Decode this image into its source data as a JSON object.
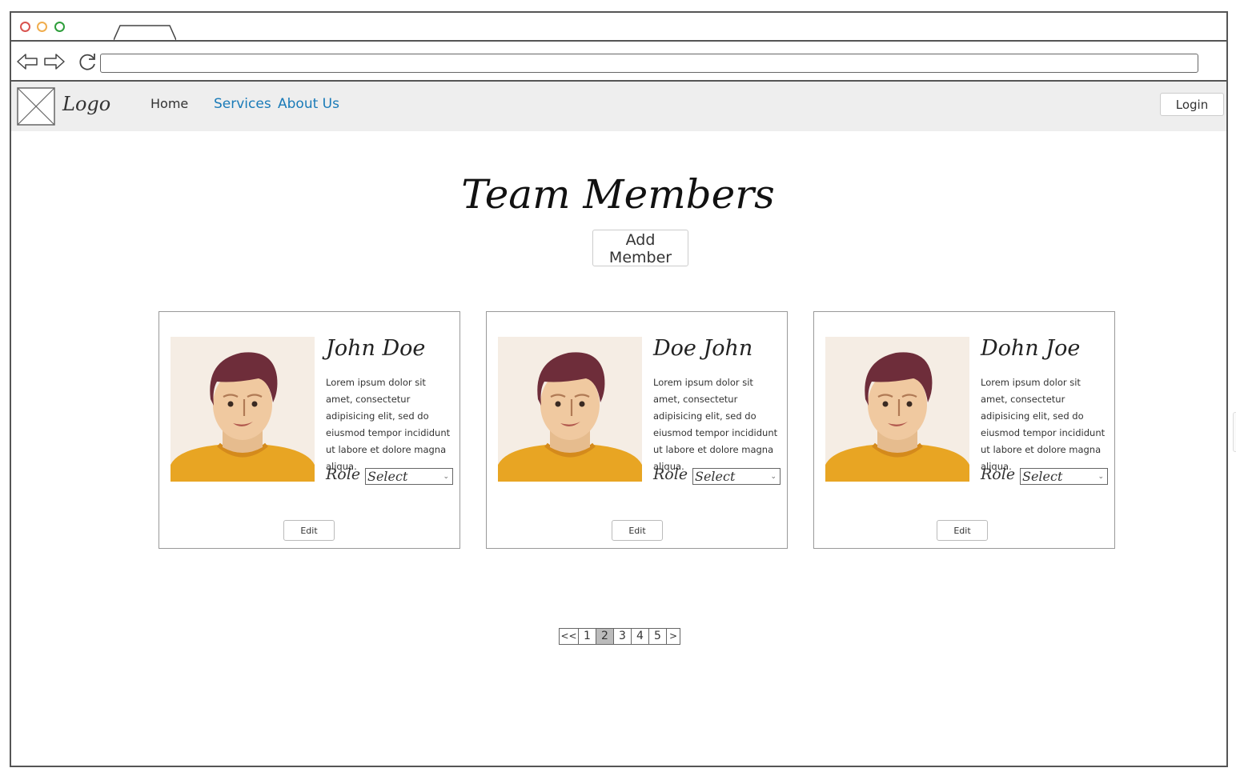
{
  "browser": {
    "url": "",
    "back_icon": "arrow-left-icon",
    "forward_icon": "arrow-right-icon",
    "reload_icon": "reload-icon"
  },
  "navbar": {
    "logo_label": "Logo",
    "links": [
      "Home",
      "Services",
      "About Us"
    ],
    "login_label": "Login",
    "link_color": "#1a7bb8",
    "background": "#eeeeee"
  },
  "main": {
    "title": "Team Members",
    "add_label": "Add Member"
  },
  "members": [
    {
      "name": "John Doe",
      "bio": "Lorem ipsum dolor sit amet, consectetur adipisicing elit, sed do eiusmod tempor incididunt ut labore et dolore magna aliqua.",
      "role_label": "Role",
      "role_value": "Select",
      "edit_label": "Edit"
    },
    {
      "name": "Doe John",
      "bio": "Lorem ipsum dolor sit amet, consectetur adipisicing elit, sed do eiusmod tempor incididunt ut labore et dolore magna aliqua.",
      "role_label": "Role",
      "role_value": "Select",
      "edit_label": "Edit"
    },
    {
      "name": "Dohn Joe",
      "bio": "Lorem ipsum dolor sit amet, consectetur adipisicing elit, sed do eiusmod tempor incididunt ut labore et dolore magna aliqua.",
      "role_label": "Role",
      "role_value": "Select",
      "edit_label": "Edit"
    }
  ],
  "pagination": {
    "items": [
      "<<",
      "1",
      "2",
      "3",
      "4",
      "5",
      ">"
    ],
    "active": "2"
  }
}
